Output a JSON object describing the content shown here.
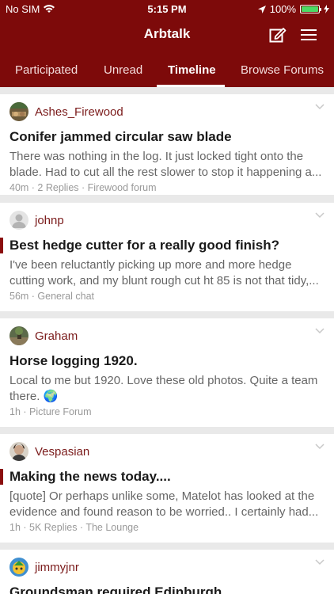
{
  "status_bar": {
    "carrier": "No SIM",
    "time": "5:15 PM",
    "battery": "100%",
    "battery_level": 1.0
  },
  "nav": {
    "title": "Arbtalk"
  },
  "tabs": [
    {
      "label": "Participated",
      "active": false
    },
    {
      "label": "Unread",
      "active": false
    },
    {
      "label": "Timeline",
      "active": true
    },
    {
      "label": "Browse Forums",
      "active": false
    }
  ],
  "colors": {
    "brand": "#7d0a0a",
    "author": "#7a1a1a",
    "unread_marker": "#8b0e0e"
  },
  "posts": [
    {
      "author": "Ashes_Firewood",
      "title": "Conifer jammed circular saw blade",
      "excerpt": [
        "There was nothing in the log. It just locked tight onto the",
        "blade. Had to cut all the rest slower to stop it happening a..."
      ],
      "meta": "40m · 2 Replies · Firewood forum",
      "unread": false
    },
    {
      "author": "johnp",
      "title": "Best hedge cutter for a really good finish?",
      "excerpt": [
        "I've been reluctantly picking up more and more hedge",
        "cutting work, and my blunt rough cut ht 85 is not that tidy,..."
      ],
      "meta": "56m · General chat",
      "unread": true
    },
    {
      "author": "Graham",
      "title": "Horse logging 1920.",
      "excerpt": [
        "Local to me but 1920.  Love these old photos.  Quite a team",
        "there. 🌍"
      ],
      "meta": "1h · Picture Forum",
      "unread": false
    },
    {
      "author": "Vespasian",
      "title": "Making the news today....",
      "excerpt": [
        "[quote]   Or perhaps unlike some, Matelot has looked at the",
        "evidence and found reason to be worried..   I certainly had..."
      ],
      "meta": "1h · 5K Replies · The Lounge",
      "unread": true
    },
    {
      "author": "jimmyjnr",
      "title": "Groundsman required Edinburgh",
      "excerpt": [
        "",
        ""
      ],
      "meta": "",
      "unread": false
    }
  ]
}
